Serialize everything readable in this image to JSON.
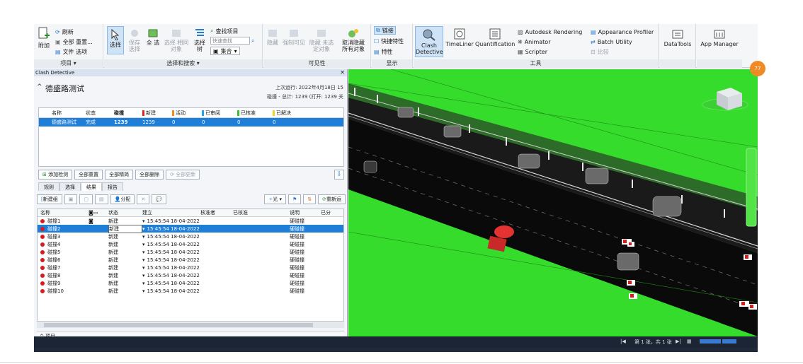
{
  "ribbon": {
    "append": "附加",
    "refresh": "刷新",
    "reset_all": "全部 重置...",
    "file_options": "文件 选项",
    "project_group": "项目 ▾",
    "select": "选择",
    "save_selection": "保存 选择",
    "select_all": "全 选",
    "select_same": "选择 相同对象",
    "select_tree": "选择 树",
    "find_items": "查找项目",
    "quick_find_placeholder": "快速查找",
    "sets_label": "集合",
    "select_search_group": "选择和搜索 ▾",
    "hide": "隐藏",
    "require": "强制可见",
    "hide_unselected": "隐藏 未选定对象",
    "unhide_all": "取消隐藏 所有对象",
    "visibility_group": "可见性",
    "links": "链接",
    "quick_props": "快捷特性",
    "properties": "特性",
    "display_group": "显示",
    "clash_detective": "Clash Detective",
    "timeliner": "TimeLiner",
    "quantification": "Quantification",
    "autodesk_rendering": "Autodesk Rendering",
    "animator": "Animator",
    "scripter": "Scripter",
    "appearance_profiler": "Appearance Profiler",
    "batch_utility": "Batch Utility",
    "compare": "比较",
    "tools_group": "工具",
    "datatools": "DataTools",
    "app_manager": "App Manager"
  },
  "panel": {
    "title": "Clash Detective",
    "test_name": "德盛路测试",
    "last_run": "上次运行: 2022年4月18日 15",
    "clash_total": "碰撞 - 总计: 1239 (打开: 1239 关",
    "test_table": {
      "headers": [
        "名称",
        "状态",
        "碰撞",
        "新建",
        "活动",
        "已审阅",
        "已核准",
        "已解决"
      ],
      "row": [
        "德盛路测试",
        "完成",
        "1239",
        "1239",
        "0",
        "0",
        "0",
        "0"
      ]
    },
    "buttons": {
      "add_test": "添加检测",
      "reset_all": "全部重置",
      "compact_all": "全部精简",
      "delete_all": "全部删除",
      "update_all": "全部更新"
    },
    "tabs": [
      "规则",
      "选择",
      "结果",
      "报告"
    ],
    "results_toolbar": {
      "new_group": "新建组",
      "assign": "分配",
      "highlight": "光",
      "refresh": "重新运"
    },
    "results": {
      "headers": [
        "名称",
        "状态",
        "建立",
        "核准者",
        "已核准",
        "说明",
        "已分"
      ],
      "rows": [
        {
          "name": "碰撞1",
          "status": "新建",
          "found": "15:45:54 18-04-2022",
          "desc": "硬碰撞"
        },
        {
          "name": "碰撞2",
          "status": "新建",
          "found": "15:45:54 18-04-2022",
          "desc": "硬碰撞"
        },
        {
          "name": "碰撞3",
          "status": "新建",
          "found": "15:45:54 18-04-2022",
          "desc": "硬碰撞"
        },
        {
          "name": "碰撞4",
          "status": "新建",
          "found": "15:45:54 18-04-2022",
          "desc": "硬碰撞"
        },
        {
          "name": "碰撞5",
          "status": "新建",
          "found": "15:45:54 18-04-2022",
          "desc": "硬碰撞"
        },
        {
          "name": "碰撞6",
          "status": "新建",
          "found": "15:45:54 18-04-2022",
          "desc": "硬碰撞"
        },
        {
          "name": "碰撞7",
          "status": "新建",
          "found": "15:45:54 18-04-2022",
          "desc": "硬碰撞"
        },
        {
          "name": "碰撞8",
          "status": "新建",
          "found": "15:45:54 18-04-2022",
          "desc": "硬碰撞"
        },
        {
          "name": "碰撞9",
          "status": "新建",
          "found": "15:45:54 18-04-2022",
          "desc": "硬碰撞"
        },
        {
          "name": "碰撞10",
          "status": "新建",
          "found": "15:45:54 18-04-2022",
          "desc": "硬碰撞"
        }
      ]
    },
    "items_label": "项目"
  },
  "statusbar": {
    "page": "第 1 张，共 1 张"
  },
  "badge": "77",
  "colors": {
    "accent": "#1f7ed8",
    "green": "#36dc2c",
    "clash_red": "#d61c1c"
  }
}
